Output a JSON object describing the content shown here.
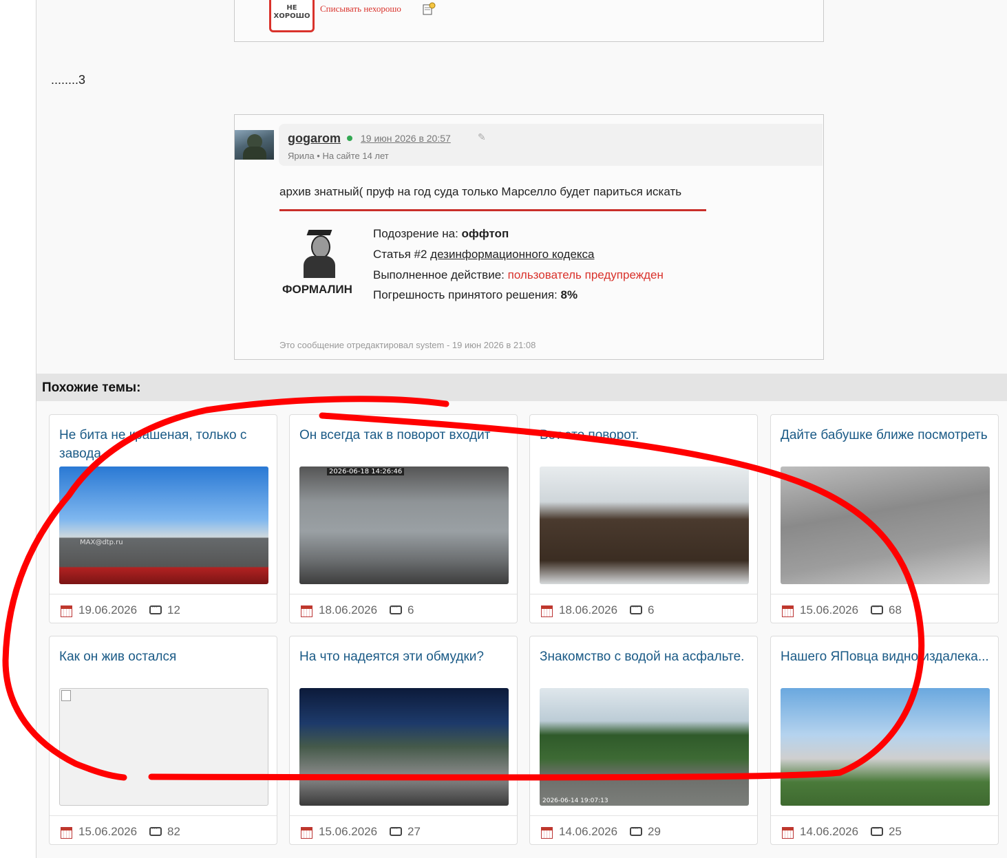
{
  "prev_post": {
    "stamp_line1": "НЕ",
    "stamp_line2": "ХОРОШО",
    "caption": "Списывать нехорошо"
  },
  "separator_text": "........3",
  "quoted_post": {
    "username": "gogarom",
    "date": "19 июн 2026 в 20:57",
    "user_meta": "Ярила  •  На сайте 14 лет",
    "text": "архив знатный( пруф на год суда только Марселло будет париться искать",
    "moderator_name": "ФОРМАЛИН",
    "suspicion_label": "Подозрение на: ",
    "suspicion_value": "оффтоп",
    "article_prefix": "Статья #2 ",
    "article_link": "дезинформационного кодекса",
    "action_label": "Выполненное действие: ",
    "action_value": "пользователь предупрежден",
    "error_label": "Погрешность принятого решения: ",
    "error_value": "8%",
    "edited_note": "Это сообщение отредактировал system - 19 июн 2026 в 21:08"
  },
  "similar": {
    "title": "Похожие темы:",
    "cards": [
      {
        "title": "Не бита не крашеная, только с завода",
        "date": "19.06.2026",
        "comments": "12",
        "thumb_overlay": "MAX@dtp.ru"
      },
      {
        "title": "Он всегда так в поворот входит",
        "date": "18.06.2026",
        "comments": "6",
        "thumb_overlay": "2026-06-18 14:26:46"
      },
      {
        "title": "Вот это поворот.",
        "date": "18.06.2026",
        "comments": "6",
        "thumb_overlay": ""
      },
      {
        "title": "Дайте бабушке ближе посмотреть",
        "date": "15.06.2026",
        "comments": "68",
        "thumb_overlay": ""
      },
      {
        "title": "Как он жив остался",
        "date": "15.06.2026",
        "comments": "82",
        "thumb_overlay": ""
      },
      {
        "title": "На что надеятся эти обмудки?",
        "date": "15.06.2026",
        "comments": "27",
        "thumb_overlay": ""
      },
      {
        "title": "Знакомство с водой на асфальте.",
        "date": "14.06.2026",
        "comments": "29",
        "thumb_overlay": "2026-06-14 19:07:13"
      },
      {
        "title": "Нашего ЯПовца видно издалека...",
        "date": "14.06.2026",
        "comments": "25",
        "thumb_overlay": ""
      }
    ]
  },
  "colors": {
    "link_blue": "#1a5a86",
    "warning_red": "#d9322b",
    "annotation_red": "#ff0000"
  }
}
